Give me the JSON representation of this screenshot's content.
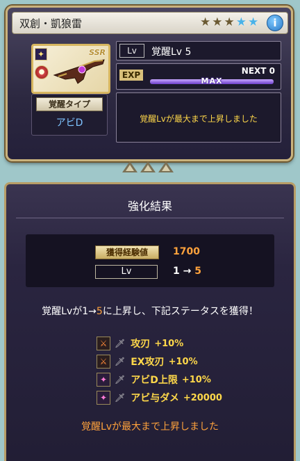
{
  "weapon": {
    "name": "双創・凱狼雷",
    "stars": [
      {
        "state": "filled",
        "glyph": "★"
      },
      {
        "state": "filled",
        "glyph": "★"
      },
      {
        "state": "filled",
        "glyph": "★"
      },
      {
        "state": "empty",
        "glyph": "★"
      },
      {
        "state": "empty",
        "glyph": "★"
      }
    ],
    "info_glyph": "i",
    "rarity": "SSR",
    "element_icon": "star-icon",
    "type_icon": "gun-icon"
  },
  "awaken_type": {
    "label": "覚醒タイプ",
    "value": "アビD"
  },
  "level": {
    "tag": "Lv",
    "text": "覚醒Lv 5"
  },
  "exp": {
    "tag": "EXP",
    "next": "NEXT 0",
    "max": "MAX",
    "fill_fraction": 1.0
  },
  "status_message": "覚醒Lvが最大まで上昇しました",
  "result": {
    "title": "強化結果",
    "gain_label": "獲得経験値",
    "gain_value": "1700",
    "lv_label": "Lv",
    "lv_from": "1",
    "lv_arrow": "→",
    "lv_to": "5",
    "summary_prefix": "覚醒Lvが1→",
    "summary_to": "5",
    "summary_suffix": "に上昇し、下記ステータスを獲得！",
    "skills": [
      {
        "icon": "blade-icon",
        "glyph": "⚔",
        "name": "攻刃",
        "value": "+10%"
      },
      {
        "icon": "blade-icon",
        "glyph": "⚔",
        "name": "EX攻刃",
        "value": "+10%"
      },
      {
        "icon": "magic-icon",
        "glyph": "✦",
        "name": "アビD上限",
        "value": "+10%"
      },
      {
        "icon": "magic-icon",
        "glyph": "✦",
        "name": "アビ与ダメ",
        "value": "+20000"
      }
    ],
    "footer": "覚醒Lvが最大まで上昇しました"
  },
  "colors": {
    "accent": "#ffa23c",
    "highlight": "#ffd84a",
    "frame": "#c9b27d"
  }
}
